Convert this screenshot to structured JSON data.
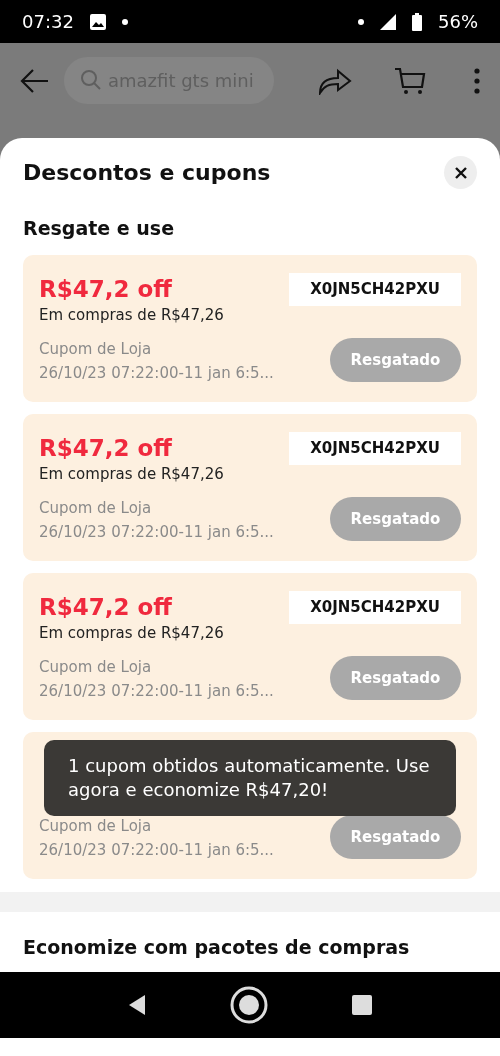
{
  "status_bar": {
    "time": "07:32",
    "battery": "56%"
  },
  "header": {
    "search": {
      "placeholder": "amazfit gts mini"
    }
  },
  "sheet": {
    "title": "Descontos e cupons",
    "section": "Resgate e use",
    "coupons": [
      {
        "title": "R$47,2 off",
        "code": "X0JN5CH42PXU",
        "min": "Em compras de R$47,26",
        "type": "Cupom de Loja",
        "validity": "26/10/23 07:22:00-11 jan 6:5...",
        "button": {
          "label": "Resgatado",
          "disabled": true
        }
      },
      {
        "title": "R$47,2 off",
        "code": "X0JN5CH42PXU",
        "min": "Em compras de R$47,26",
        "type": "Cupom de Loja",
        "validity": "26/10/23 07:22:00-11 jan 6:5...",
        "button": {
          "label": "Resgatado",
          "disabled": true
        }
      },
      {
        "title": "R$47,2 off",
        "code": "X0JN5CH42PXU",
        "min": "Em compras de R$47,26",
        "type": "Cupom de Loja",
        "validity": "26/10/23 07:22:00-11 jan 6:5...",
        "button": {
          "label": "Resgatado",
          "disabled": true
        }
      },
      {
        "type": "Cupom de Loja",
        "validity": "26/10/23 07:22:00-11 jan 6:5...",
        "button": {
          "label": "Resgatado",
          "disabled": true
        }
      }
    ],
    "toast": "1 cupom obtidos automaticamente. Use agora e economize R$47,20!",
    "bundles_title": "Economize com pacotes de compras"
  }
}
